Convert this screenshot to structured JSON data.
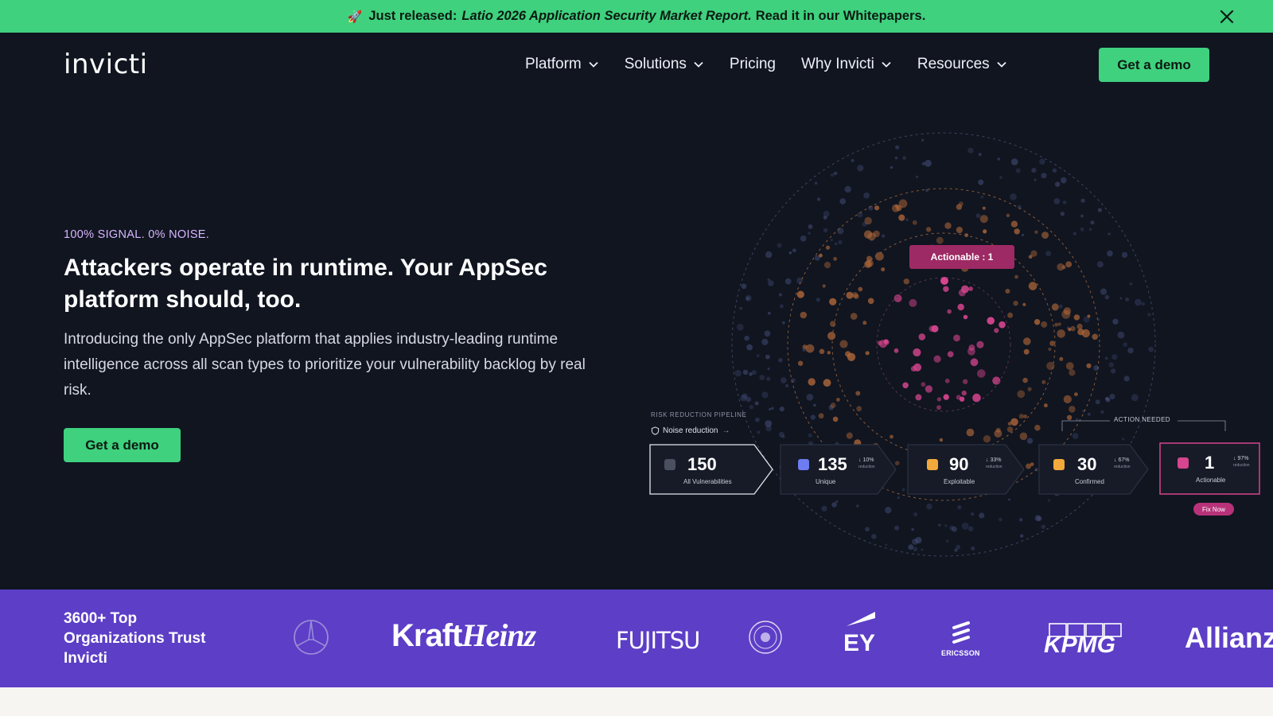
{
  "announcement": {
    "icon": "rocket-icon",
    "prefix": "Just released:",
    "report": "Latio 2026 Application Security Market Report.",
    "suffix": "Read it in our Whitepapers."
  },
  "header": {
    "logo": "invicti",
    "nav": [
      {
        "label": "Platform"
      },
      {
        "label": "Solutions"
      },
      {
        "label": "Pricing"
      },
      {
        "label": "Why Invicti"
      },
      {
        "label": "Resources"
      }
    ],
    "cta": "Get a demo"
  },
  "hero": {
    "eyebrow": "100% SIGNAL. 0% NOISE.",
    "headline": "Attackers operate in runtime. Your AppSec platform should, too.",
    "subtext": "Introducing the only AppSec platform that applies industry-leading runtime intelligence across all scan types to prioritize your vulnerability backlog by real risk.",
    "cta": "Get a demo"
  },
  "viz": {
    "tooltip": "Actionable : 1",
    "pipeline_label": "RISK REDUCTION PIPELINE",
    "noise_label": "Noise reduction",
    "action_needed": "ACTION NEEDED",
    "fix_now": "Fix Now",
    "cards": [
      {
        "value": "150",
        "label": "All Vulnerabilities",
        "reduction": "",
        "color": "#6b7280"
      },
      {
        "value": "135",
        "label": "Unique",
        "reduction": "↓ 10%",
        "color": "#6d7cf0"
      },
      {
        "value": "90",
        "label": "Exploitable",
        "reduction": "↓ 33%",
        "color": "#f2a93b"
      },
      {
        "value": "30",
        "label": "Confirmed",
        "reduction": "↓ 67%",
        "color": "#f2a93b"
      },
      {
        "value": "1",
        "label": "Actionable",
        "reduction": "↓ 97%",
        "color": "#d6458e"
      }
    ],
    "reduction_word": "reduction",
    "colors": {
      "outer": "#4a5380",
      "middle": "#b56a3a",
      "inner": "#d6458e"
    }
  },
  "trust": {
    "title": "3600+ Top Organizations Trust Invicti",
    "logos": {
      "kraft_a": "Kraft",
      "kraft_b": "Heinz",
      "fujitsu": "FUJITSU",
      "ey": "EY",
      "ericsson": "ERICSSON",
      "kpmg": "KPMG",
      "allianz": "Allianz"
    }
  }
}
